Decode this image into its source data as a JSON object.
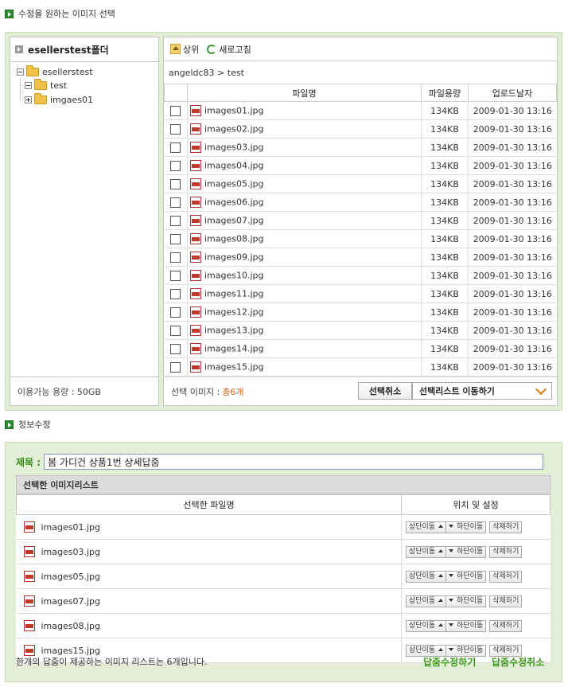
{
  "section1": {
    "title": "수정을 원하는 이미지 선택"
  },
  "tree": {
    "header": "esellerstest폴더",
    "root": "esellerstest",
    "children": [
      "test",
      "imgaes01"
    ],
    "footer": "이용가능 용량 : 50GB"
  },
  "toolbar": {
    "up": "상위",
    "refresh": "새로고침"
  },
  "breadcrumb": "angeldc83 > test",
  "file_table": {
    "headers": {
      "name": "파일명",
      "size": "파일용량",
      "date": "업로드날자"
    },
    "rows": [
      {
        "name": "images01.jpg",
        "size": "134KB",
        "date": "2009-01-30 13:16"
      },
      {
        "name": "images02.jpg",
        "size": "134KB",
        "date": "2009-01-30 13:16"
      },
      {
        "name": "images03.jpg",
        "size": "134KB",
        "date": "2009-01-30 13:16"
      },
      {
        "name": "images04.jpg",
        "size": "134KB",
        "date": "2009-01-30 13:16"
      },
      {
        "name": "images05.jpg",
        "size": "134KB",
        "date": "2009-01-30 13:16"
      },
      {
        "name": "images06.jpg",
        "size": "134KB",
        "date": "2009-01-30 13:16"
      },
      {
        "name": "images07.jpg",
        "size": "134KB",
        "date": "2009-01-30 13:16"
      },
      {
        "name": "images08.jpg",
        "size": "134KB",
        "date": "2009-01-30 13:16"
      },
      {
        "name": "images09.jpg",
        "size": "134KB",
        "date": "2009-01-30 13:16"
      },
      {
        "name": "images10.jpg",
        "size": "134KB",
        "date": "2009-01-30 13:16"
      },
      {
        "name": "images11.jpg",
        "size": "134KB",
        "date": "2009-01-30 13:16"
      },
      {
        "name": "images12.jpg",
        "size": "134KB",
        "date": "2009-01-30 13:16"
      },
      {
        "name": "images13.jpg",
        "size": "134KB",
        "date": "2009-01-30 13:16"
      },
      {
        "name": "images14.jpg",
        "size": "134KB",
        "date": "2009-01-30 13:16"
      },
      {
        "name": "images15.jpg",
        "size": "134KB",
        "date": "2009-01-30 13:16"
      }
    ]
  },
  "file_footer": {
    "label": "선택 이미지 :",
    "count": "총6개",
    "cancel": "선택취소",
    "move": "선택리스트 이동하기"
  },
  "section2": {
    "title": "정보수정"
  },
  "info": {
    "title_label": "제목 :",
    "title_value": "봄 가디건 상품1번 상세답줌",
    "list_header": "선택한 이미지리스트",
    "col_name": "선택한 파일명",
    "col_setting": "위치 및 설정",
    "btn_up": "상단이동",
    "btn_down": "하단이동",
    "btn_delete": "삭제하기",
    "items": [
      "images01.jpg",
      "images03.jpg",
      "images05.jpg",
      "images07.jpg",
      "images08.jpg",
      "images15.jpg"
    ],
    "footer_note": "한개의 답줌이 제공하는 이미지 리스트는 6개입니다.",
    "save": "답줌수정하기",
    "cancel": "답줌수정취소"
  },
  "colors": {
    "accent_green": "#3a9a1a",
    "frame_green": "#e2efd6",
    "count_orange": "#d9621a"
  }
}
